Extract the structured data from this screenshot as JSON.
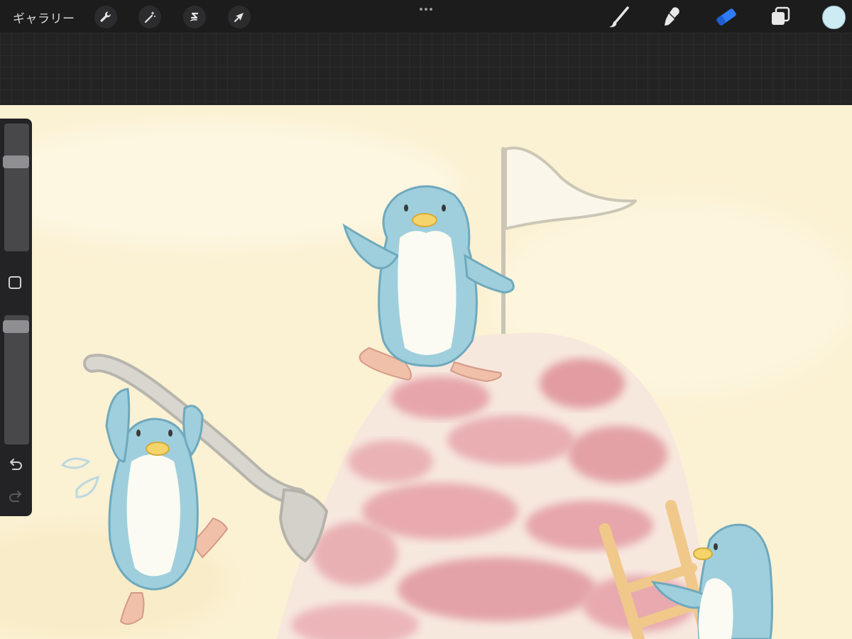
{
  "toolbar": {
    "gallery_label": "ギャラリー",
    "left_tools": [
      {
        "name": "actions",
        "icon": "wrench-icon"
      },
      {
        "name": "adjustments",
        "icon": "magic-wand-icon"
      },
      {
        "name": "selection",
        "icon": "selection-s-icon"
      },
      {
        "name": "transform",
        "icon": "arrow-cursor-icon"
      }
    ],
    "center": {
      "icon": "more-dots-icon"
    },
    "right_tools": [
      {
        "name": "brush",
        "icon": "brush-icon",
        "active": false
      },
      {
        "name": "smudge",
        "icon": "smudge-icon",
        "active": false
      },
      {
        "name": "eraser",
        "icon": "eraser-icon",
        "active": true
      },
      {
        "name": "layers",
        "icon": "layers-icon",
        "active": false
      }
    ],
    "current_color": "#cdebf3"
  },
  "sidebar": {
    "brush_size_level": 0.72,
    "opacity_level": 0.96,
    "modify_icon": "square-icon",
    "undo_icon": "undo-icon",
    "redo_icon": "redo-icon"
  },
  "colors": {
    "accent_active": "#2f7bf6",
    "canvas_bg": "#fbf1d3",
    "penguin": "#a7d5e1",
    "shaved_ice": "#e8a7ac"
  }
}
